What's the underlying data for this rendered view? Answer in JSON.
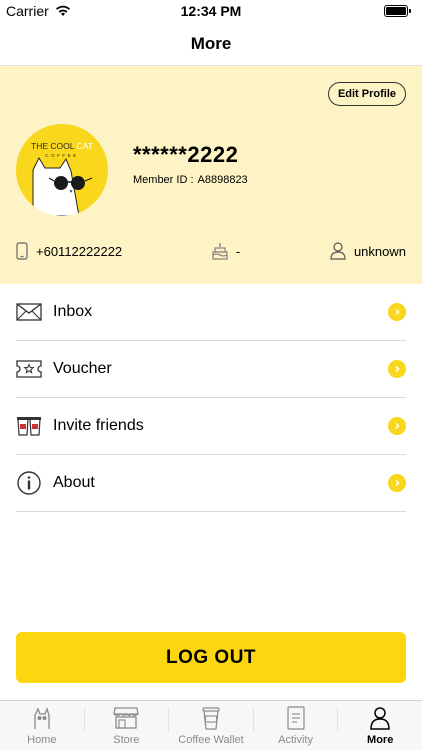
{
  "status": {
    "carrier": "Carrier",
    "time": "12:34 PM"
  },
  "nav": {
    "title": "More"
  },
  "profile": {
    "edit_label": "Edit Profile",
    "name": "******2222",
    "member_id_label": "Member ID :",
    "member_id": "A8898823",
    "phone": "+60112222222",
    "birthday": "-",
    "gender": "unknown",
    "logo": {
      "line1": "THE COOL",
      "line2": "CAT",
      "line3": "COFFEE"
    }
  },
  "menu": {
    "items": [
      {
        "label": "Inbox",
        "icon": "envelope-icon"
      },
      {
        "label": "Voucher",
        "icon": "voucher-icon"
      },
      {
        "label": "Invite friends",
        "icon": "invite-friends-icon"
      },
      {
        "label": "About",
        "icon": "info-icon"
      }
    ]
  },
  "logout_label": "LOG OUT",
  "tabs": [
    {
      "label": "Home",
      "icon": "cat-icon"
    },
    {
      "label": "Store",
      "icon": "store-icon"
    },
    {
      "label": "Coffee Wallet",
      "icon": "coffee-cup-icon"
    },
    {
      "label": "Activity",
      "icon": "document-icon"
    },
    {
      "label": "More",
      "icon": "person-icon",
      "active": true
    }
  ],
  "colors": {
    "accent": "#fcd711",
    "profile_bg": "#fdf3c4",
    "chevron": "#f9d71c"
  }
}
